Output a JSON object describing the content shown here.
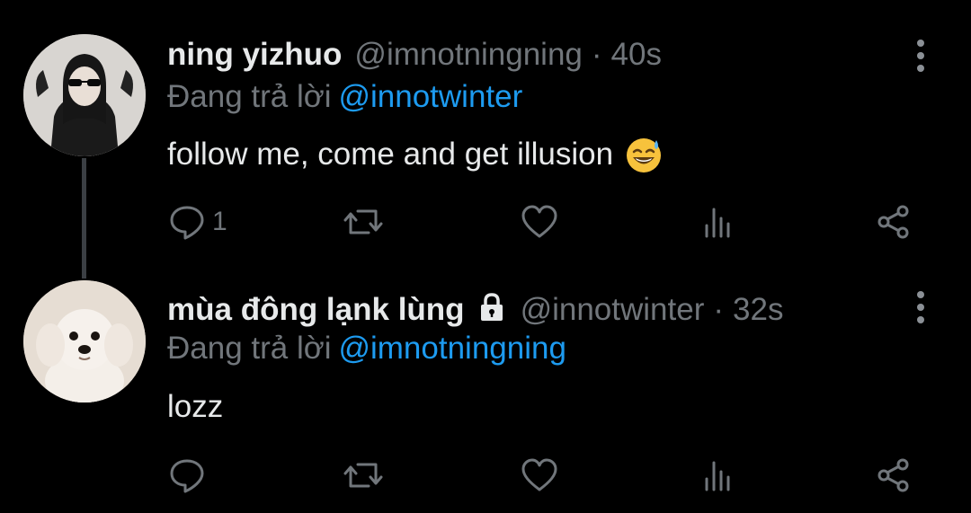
{
  "reply_prefix": "Đang trả lời",
  "tweets": [
    {
      "name": "ning yizhuo",
      "handle": "@imnotningning",
      "separator": "·",
      "time": "40s",
      "reply_to": "@innotwinter",
      "text": "follow me, come and get illusion",
      "emoji": "sweat-smile-emoji",
      "reply_count": "1",
      "protected": false
    },
    {
      "name": "mùa đông lạnk lùng",
      "handle": "@innotwinter",
      "separator": "·",
      "time": "32s",
      "reply_to": "@imnotningning",
      "text": "lozz",
      "reply_count": "",
      "protected": true,
      "lock_icon": "lock-icon"
    }
  ],
  "icons": {
    "reply": "reply-icon",
    "retweet": "retweet-icon",
    "like": "heart-icon",
    "views": "views-icon",
    "share": "share-icon",
    "more": "more-vertical-icon"
  },
  "colors": {
    "background": "#000000",
    "text": "#e7e9ea",
    "muted": "#71767b",
    "link": "#1d9bf0",
    "thread_line": "#3b3f44"
  }
}
